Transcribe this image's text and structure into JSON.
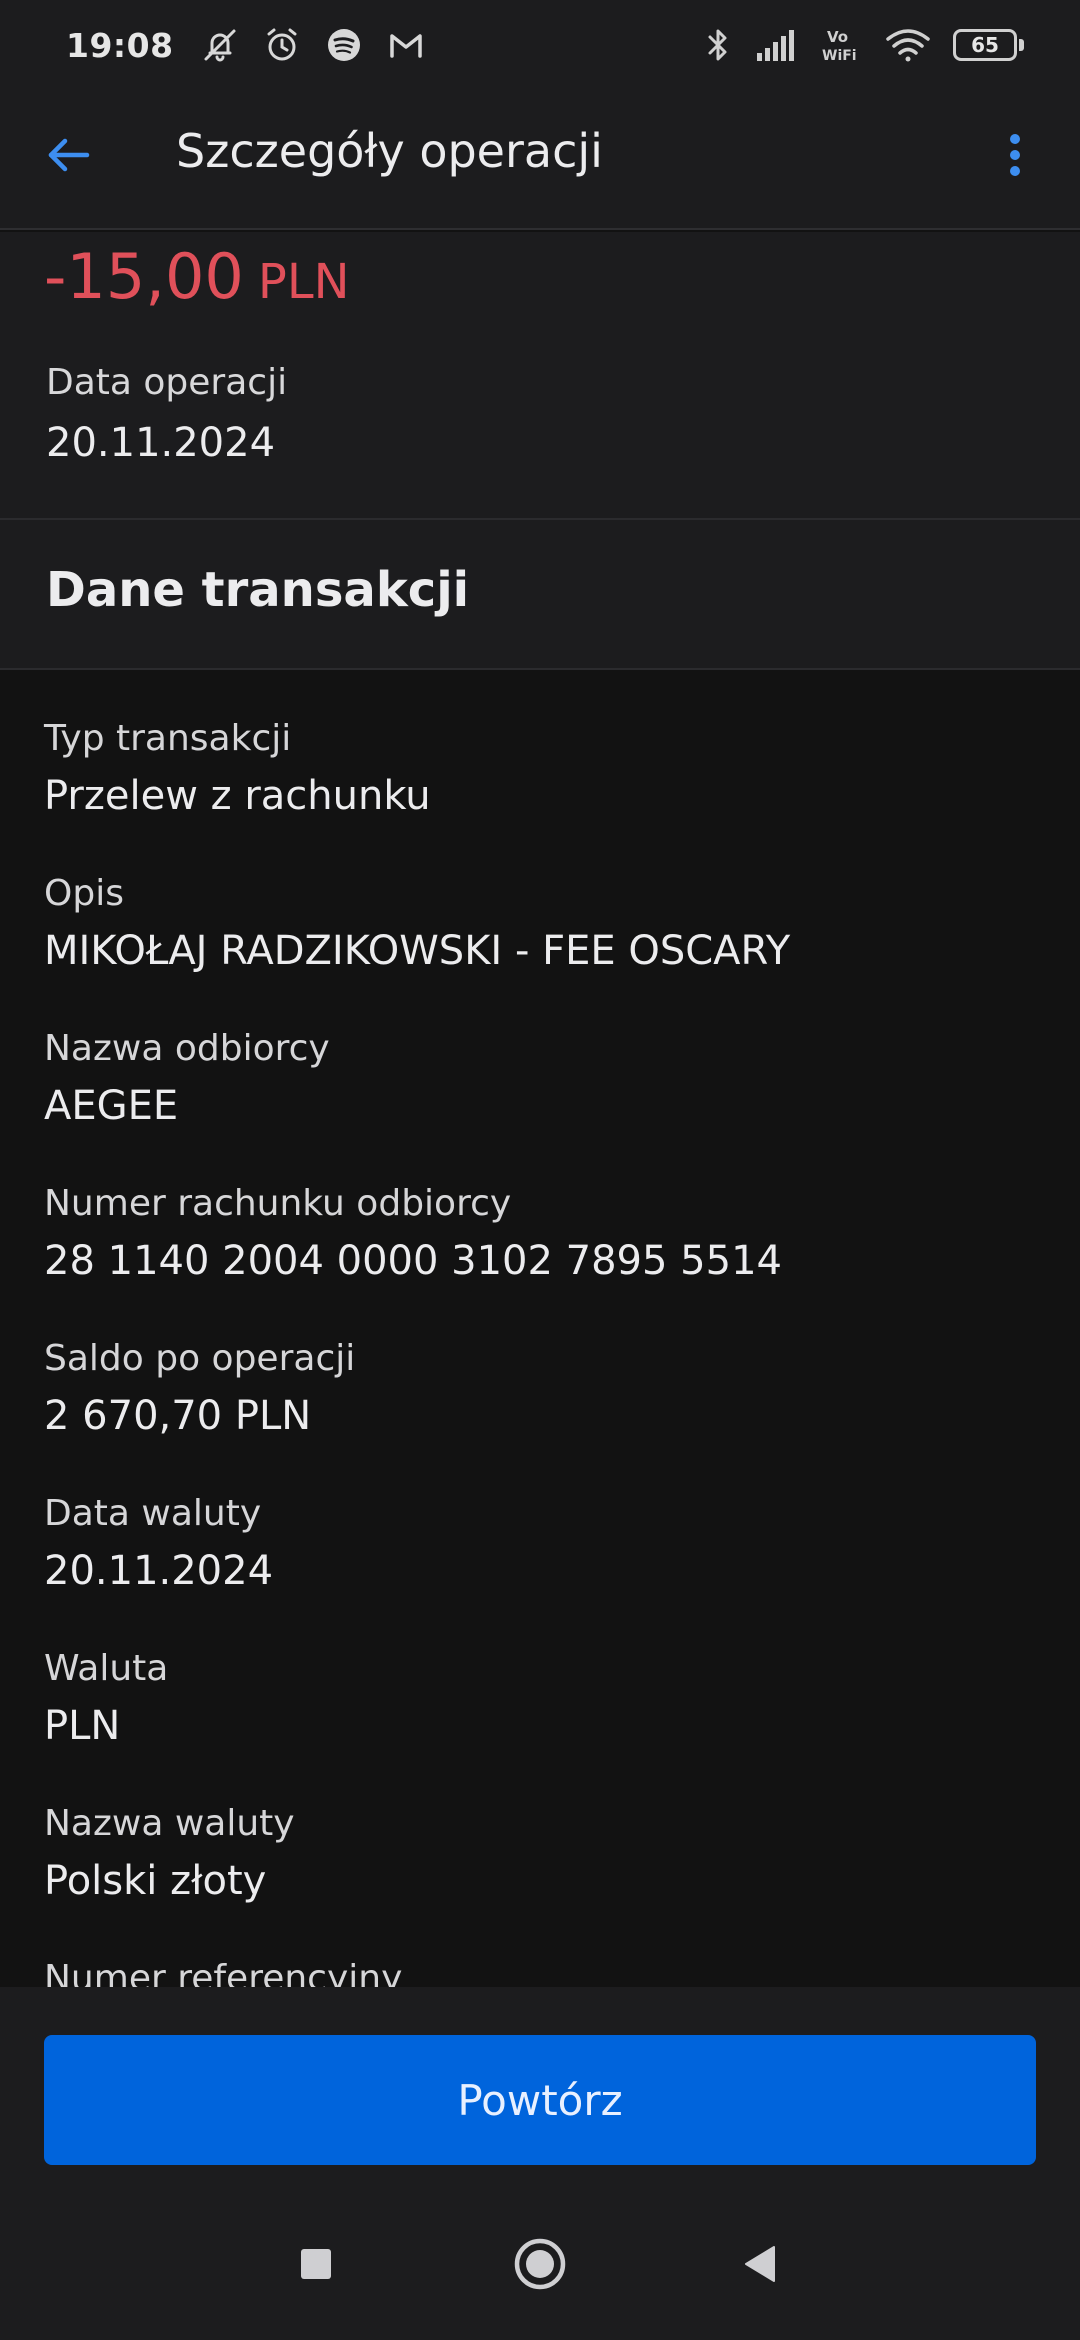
{
  "status_bar": {
    "time": "19:08",
    "battery": "65",
    "icons_left": [
      "mute-icon",
      "alarm-icon",
      "spotify-icon",
      "gmail-icon"
    ],
    "icons_right": [
      "bluetooth-icon",
      "signal-icon",
      "vowifi-icon",
      "wifi-icon",
      "battery-icon"
    ],
    "vowifi_top": "Vo",
    "vowifi_bottom": "WiFi"
  },
  "header": {
    "title": "Szczegóły operacji",
    "back_icon": "arrow-left-icon",
    "menu_icon": "more-vertical-icon"
  },
  "summary": {
    "amount": "-15,00",
    "currency": "PLN",
    "date_label": "Data operacji",
    "date_value": "20.11.2024"
  },
  "section": {
    "title": "Dane transakcji"
  },
  "details": [
    {
      "label": "Typ transakcji",
      "value": "Przelew z rachunku"
    },
    {
      "label": "Opis",
      "value": "MIKOŁAJ RADZIKOWSKI - FEE OSCARY"
    },
    {
      "label": "Nazwa odbiorcy",
      "value": "AEGEE"
    },
    {
      "label": "Numer rachunku odbiorcy",
      "value": "28 1140 2004 0000 3102 7895 5514"
    },
    {
      "label": "Saldo po operacji",
      "value": "2 670,70 PLN"
    },
    {
      "label": "Data waluty",
      "value": "20.11.2024"
    },
    {
      "label": "Waluta",
      "value": "PLN"
    },
    {
      "label": "Nazwa waluty",
      "value": "Polski złoty"
    },
    {
      "label": "Numer referencyjny",
      "value": ""
    }
  ],
  "actions": {
    "repeat_label": "Powtórz"
  },
  "colors": {
    "accent": "#0064dc",
    "negative_amount": "#e0505a",
    "background": "#121212",
    "surface": "#1c1c1e"
  }
}
